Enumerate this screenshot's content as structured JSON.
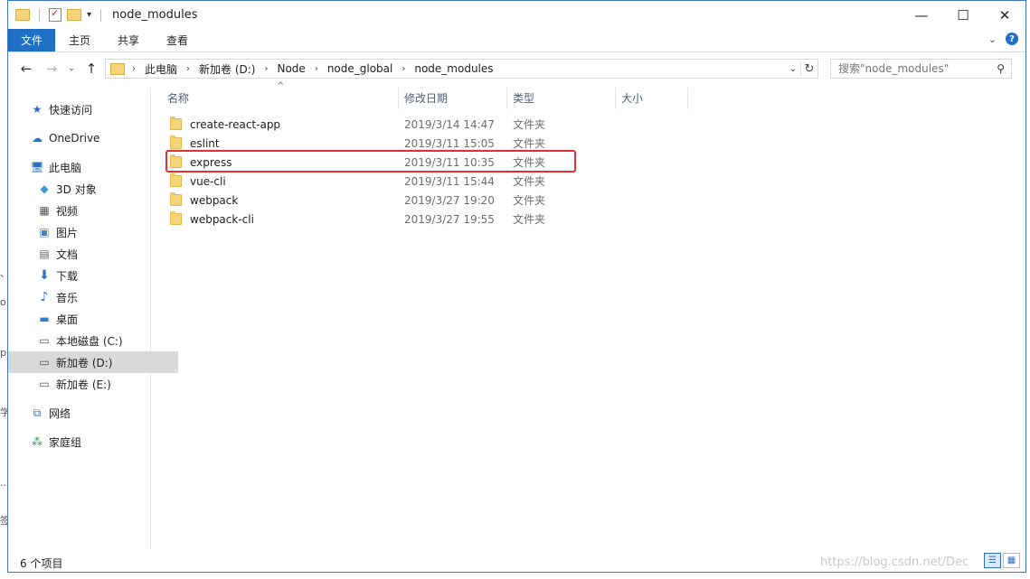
{
  "window": {
    "title": "node_modules"
  },
  "titlebar": {
    "minimize_symbol": "—",
    "maximize_symbol": "☐",
    "close_symbol": "✕"
  },
  "ribbon": {
    "tabs": [
      {
        "label": "文件",
        "active": true
      },
      {
        "label": "主页"
      },
      {
        "label": "共享"
      },
      {
        "label": "查看"
      }
    ],
    "help_symbol": "?"
  },
  "address": {
    "breadcrumbs": [
      "此电脑",
      "新加卷 (D:)",
      "Node",
      "node_global",
      "node_modules"
    ]
  },
  "search": {
    "placeholder": "搜索\"node_modules\""
  },
  "sidebar": {
    "items": [
      {
        "label": "快速访问",
        "icon": "star-icon"
      },
      {
        "label": "OneDrive",
        "icon": "cloud-icon"
      },
      {
        "label": "此电脑",
        "icon": "computer-icon"
      },
      {
        "label": "3D 对象",
        "icon": "cube-icon"
      },
      {
        "label": "视频",
        "icon": "video-icon"
      },
      {
        "label": "图片",
        "icon": "picture-icon"
      },
      {
        "label": "文档",
        "icon": "document-icon"
      },
      {
        "label": "下载",
        "icon": "download-icon"
      },
      {
        "label": "音乐",
        "icon": "music-icon"
      },
      {
        "label": "桌面",
        "icon": "desktop-icon"
      },
      {
        "label": "本地磁盘 (C:)",
        "icon": "drive-icon"
      },
      {
        "label": "新加卷 (D:)",
        "icon": "drive-icon",
        "selected": true
      },
      {
        "label": "新加卷 (E:)",
        "icon": "drive-icon"
      },
      {
        "label": "网络",
        "icon": "network-icon"
      },
      {
        "label": "家庭组",
        "icon": "homegroup-icon"
      }
    ]
  },
  "columns": {
    "name": "名称",
    "modified": "修改日期",
    "type": "类型",
    "size": "大小"
  },
  "files": [
    {
      "name": "create-react-app",
      "modified": "2019/3/14 14:47",
      "type": "文件夹"
    },
    {
      "name": "eslint",
      "modified": "2019/3/11 15:05",
      "type": "文件夹"
    },
    {
      "name": "express",
      "modified": "2019/3/11 10:35",
      "type": "文件夹",
      "highlighted": true
    },
    {
      "name": "vue-cli",
      "modified": "2019/3/11 15:44",
      "type": "文件夹"
    },
    {
      "name": "webpack",
      "modified": "2019/3/27 19:20",
      "type": "文件夹"
    },
    {
      "name": "webpack-cli",
      "modified": "2019/3/27 19:55",
      "type": "文件夹"
    }
  ],
  "status": {
    "item_count": "6 个项目"
  },
  "watermark": "https://blog.csdn.net/Dec",
  "colors": {
    "accent": "#1f6fc5",
    "highlight_border": "#e03030",
    "folder": "#f6d47a"
  }
}
